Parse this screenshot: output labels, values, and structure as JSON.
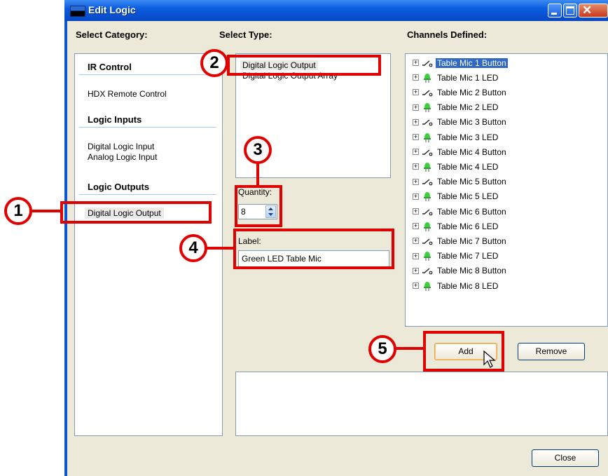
{
  "window": {
    "title": "Edit Logic"
  },
  "headers": {
    "category": "Select Category:",
    "type": "Select Type:",
    "channels": "Channels Defined:"
  },
  "categories": {
    "ir_control": {
      "title": "IR Control",
      "items": [
        "HDX Remote Control"
      ]
    },
    "logic_inputs": {
      "title": "Logic Inputs",
      "items": [
        "Digital Logic Input",
        "Analog Logic Input"
      ]
    },
    "logic_outputs": {
      "title": "Logic Outputs",
      "items": [
        "Digital Logic Output"
      ]
    }
  },
  "types": [
    "Digital Logic Output",
    "Digital Logic Output Array"
  ],
  "quantity": {
    "label": "Quantity:",
    "value": "8"
  },
  "label_field": {
    "label": "Label:",
    "value": "Green LED Table Mic"
  },
  "channels": [
    {
      "text": "Table Mic 1 Button",
      "icon": "switch-icon",
      "selected": true
    },
    {
      "text": "Table Mic 1 LED",
      "icon": "green-led-icon"
    },
    {
      "text": "Table Mic 2 Button",
      "icon": "switch-icon"
    },
    {
      "text": "Table Mic 2 LED",
      "icon": "green-led-icon"
    },
    {
      "text": "Table Mic 3 Button",
      "icon": "switch-icon"
    },
    {
      "text": "Table Mic 3 LED",
      "icon": "green-led-icon"
    },
    {
      "text": "Table Mic 4 Button",
      "icon": "switch-icon"
    },
    {
      "text": "Table Mic 4 LED",
      "icon": "green-led-icon"
    },
    {
      "text": "Table Mic 5 Button",
      "icon": "switch-icon"
    },
    {
      "text": "Table Mic 5 LED",
      "icon": "green-led-icon"
    },
    {
      "text": "Table Mic 6 Button",
      "icon": "switch-icon"
    },
    {
      "text": "Table Mic 6 LED",
      "icon": "green-led-icon"
    },
    {
      "text": "Table Mic 7 Button",
      "icon": "switch-icon"
    },
    {
      "text": "Table Mic 7 LED",
      "icon": "green-led-icon"
    },
    {
      "text": "Table Mic 8 Button",
      "icon": "switch-icon"
    },
    {
      "text": "Table Mic 8 LED",
      "icon": "green-led-icon"
    }
  ],
  "buttons": {
    "add": "Add",
    "remove": "Remove",
    "close": "Close"
  },
  "callouts": [
    "1",
    "2",
    "3",
    "4",
    "5"
  ],
  "colors": {
    "title_bar": "#0a5ce0",
    "callout_red": "#e00000",
    "selection": "#316ac5",
    "led_green": "#3ecf3e"
  }
}
